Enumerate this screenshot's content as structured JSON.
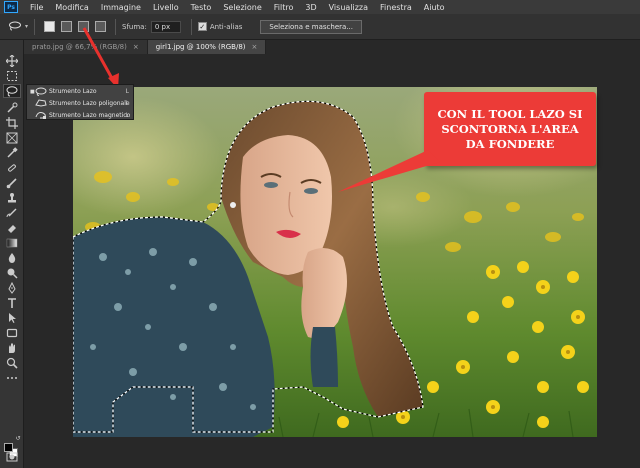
{
  "app": {
    "logo_text": "Ps",
    "menu": [
      "File",
      "Modifica",
      "Immagine",
      "Livello",
      "Testo",
      "Selezione",
      "Filtro",
      "3D",
      "Visualizza",
      "Finestra",
      "Aiuto"
    ]
  },
  "options_bar": {
    "feather_label": "Sfuma:",
    "feather_value": "0 px",
    "antialias_label": "Anti-alias",
    "antialias_checked": true,
    "select_mask_label": "Seleziona e maschera..."
  },
  "tabs": [
    {
      "label": "prato.jpg @ 66,7% (RGB/8)",
      "close": "×",
      "active": false
    },
    {
      "label": "girl1.jpg @ 100% (RGB/8)",
      "close": "×",
      "active": true
    }
  ],
  "toolbar": {
    "tools": [
      "move-tool",
      "marquee-tool",
      "lasso-tool",
      "quick-selection-tool",
      "crop-tool",
      "frame-tool",
      "eyedropper-tool",
      "healing-brush-tool",
      "brush-tool",
      "clone-stamp-tool",
      "history-brush-tool",
      "eraser-tool",
      "gradient-tool",
      "blur-tool",
      "dodge-tool",
      "pen-tool",
      "type-tool",
      "path-selection-tool",
      "rectangle-tool",
      "hand-tool",
      "zoom-tool",
      "more-tools"
    ],
    "foreground_color": "#000000",
    "background_color": "#ffffff"
  },
  "flyout": {
    "items": [
      {
        "label": "Strumento Lazo",
        "key": "L",
        "active": true
      },
      {
        "label": "Strumento Lazo poligonale",
        "key": "L",
        "active": false
      },
      {
        "label": "Strumento Lazo magnetico",
        "key": "L",
        "active": false
      }
    ]
  },
  "callout": {
    "lines": [
      "CON IL TOOL LAZO SI",
      "SCONTORNA L'AREA",
      "DA FONDERE"
    ],
    "color": "#ec3b37"
  },
  "colors": {
    "workspace": "#282828",
    "panel": "#353535",
    "arrow": "#e8312d"
  }
}
